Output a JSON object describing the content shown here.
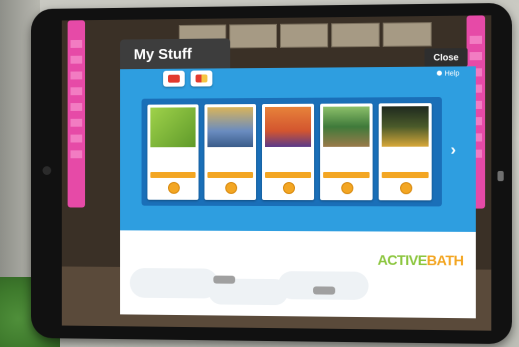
{
  "app": {
    "title": "My Stuff",
    "close_label": "Close",
    "help_label": "Help",
    "next_label": "›"
  },
  "top_tabs": [
    "",
    "",
    "",
    "",
    ""
  ],
  "icon_tabs": [
    {
      "name": "stickers-tab",
      "icon": "sticker-icon"
    },
    {
      "name": "gifts-tab",
      "icon": "gift-icon"
    }
  ],
  "items": [
    {
      "title": "",
      "thumb_color": "#7bbf3a"
    },
    {
      "title": "",
      "thumb_color": "#6a8cc0"
    },
    {
      "title": "",
      "thumb_color": "#d3552f"
    },
    {
      "title": "",
      "thumb_color": "#3f7a3a"
    },
    {
      "title": "",
      "thumb_color": "#2e3a2e"
    }
  ],
  "footer": {
    "logo_part1": "ACTIVE",
    "logo_part2": "BATH"
  },
  "colors": {
    "panel": "#2e9ee0",
    "gallery": "#1a6fb8",
    "accent": "#f3a623",
    "title_tab": "#3d3d3d"
  }
}
